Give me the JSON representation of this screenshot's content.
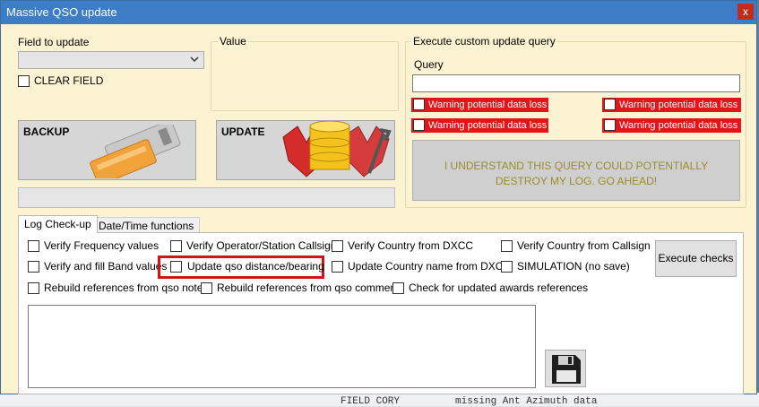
{
  "background": {
    "text_1": "FIELD CORY",
    "text_2": "missing Ant Azimuth data"
  },
  "window": {
    "title": "Massive QSO update",
    "close_label": "x"
  },
  "field_to_update": {
    "label": "Field to update",
    "selected_value": "",
    "clear_field_label": "CLEAR FIELD"
  },
  "value_group": {
    "title": "Value"
  },
  "custom_query": {
    "title": "Execute custom update query",
    "query_label": "Query",
    "query_value": "",
    "warnings": [
      "Warning potential data loss",
      "Warning potential data loss",
      "Warning potential data loss",
      "Warning potential data loss"
    ],
    "warning_color": "#e4141b",
    "confirm_button": "I UNDERSTAND THIS QUERY COULD POTENTIALLY DESTROY MY LOG. GO AHEAD!"
  },
  "buttons": {
    "backup": "BACKUP",
    "update": "UPDATE"
  },
  "tabs": [
    {
      "label": "Log Check-up",
      "active": true
    },
    {
      "label": "Date/Time functions",
      "active": false
    }
  ],
  "checks": {
    "row1": [
      "Verify Frequency values",
      "Verify Operator/Station Callsign",
      "Verify Country from DXCC",
      "Verify Country from Callsign"
    ],
    "row2": [
      "Verify and fill Band values",
      "Update qso distance/bearing",
      "Update Country name from DXCC",
      "SIMULATION (no save)"
    ],
    "row3": [
      "Rebuild references from qso notes",
      "Rebuild references from qso comments",
      "Check for updated awards references"
    ],
    "execute_button": "Execute checks",
    "highlight_color": "#d0141b"
  },
  "log_output": "",
  "icons": {
    "backup": "usb-key-icon",
    "update": "database-wrench-icon",
    "save": "floppy-disk-icon",
    "dropdown": "chevron-down-icon"
  },
  "colors": {
    "title_bar": "#3c7dc6",
    "window_bg": "#fcf3d2"
  }
}
